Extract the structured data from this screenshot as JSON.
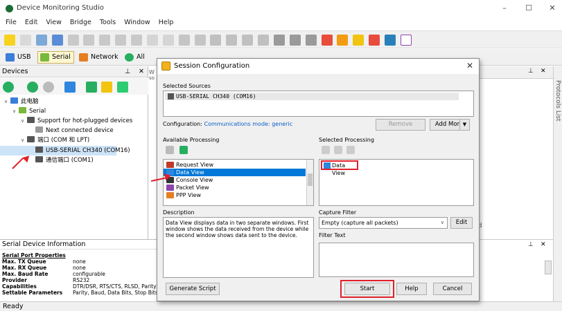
{
  "window": {
    "title": "Device Monitoring Studio",
    "min": "–",
    "max": "☐",
    "close": "✕"
  },
  "menu": [
    "File",
    "Edit",
    "View",
    "Bridge",
    "Tools",
    "Window",
    "Help"
  ],
  "tabs": [
    {
      "label": "USB"
    },
    {
      "label": "Serial"
    },
    {
      "label": "Network"
    },
    {
      "label": "All"
    }
  ],
  "devices_panel": {
    "title": "Devices",
    "pin": "⊥",
    "close": "✕",
    "tree": [
      {
        "label": "此电脑",
        "indent": 0,
        "twisty": "∨"
      },
      {
        "label": "Serial",
        "indent": 1,
        "twisty": "∨"
      },
      {
        "label": "Support for hot-plugged devices",
        "indent": 2,
        "twisty": "∨"
      },
      {
        "label": "Next connected device",
        "indent": 3,
        "twisty": ""
      },
      {
        "label": "端口 (COM 和 LPT)",
        "indent": 2,
        "twisty": "∨"
      },
      {
        "label": "USB-SERIAL CH340 (COM16)",
        "indent": 3,
        "twisty": "",
        "selected": true
      },
      {
        "label": "通信端口 (COM1)",
        "indent": 3,
        "twisty": ""
      }
    ]
  },
  "info_panel": {
    "title": "Serial Device Information",
    "section": "Serial Port Properties",
    "rows": [
      {
        "k": "Max. TX Queue",
        "v": "none"
      },
      {
        "k": "Max. RX Queue",
        "v": "none"
      },
      {
        "k": "Max. Baud Rate",
        "v": "configurable"
      },
      {
        "k": "Provider",
        "v": "RS232"
      },
      {
        "k": "Capabilities",
        "v": "DTR/DSR, RTS/CTS, RLSD, Parity"
      },
      {
        "k": "Settable Parameters",
        "v": "Parity, Baud, Data Bits, Stop Bits"
      }
    ]
  },
  "status": "Ready",
  "right_panel": {
    "pin": "⊥",
    "close": "✕",
    "frag_left_top": "W",
    "frag_left_sub": "so",
    "frag_bottom": "nd",
    "protocols": "Protocols List"
  },
  "dialog": {
    "title": "Session Configuration",
    "close": "✕",
    "selected_sources_label": "Selected Sources",
    "selected_source": "USB-SERIAL CH340 (COM16)",
    "configuration_prefix": "Configuration:",
    "configuration_value": "Communications mode: generic",
    "remove": "Remove",
    "add_more": "Add More",
    "add_more_arrow": "▼",
    "available_label": "Available Processing",
    "available_items": [
      {
        "label": "Request View",
        "color": "#c0392b"
      },
      {
        "label": "Data View",
        "color": "#2e86de",
        "selected": true
      },
      {
        "label": "Console View",
        "color": "#333333"
      },
      {
        "label": "Packet View",
        "color": "#8e44ad"
      },
      {
        "label": "PPP View",
        "color": "#e67e22"
      }
    ],
    "selected_processing_label": "Selected Processing",
    "selected_processing": [
      "Data View"
    ],
    "description_label": "Description",
    "description_text": "Data View displays data in two separate windows. First window shows the data received from the device while the second window shows data sent to the device.",
    "capture_filter_label": "Capture Filter",
    "capture_filter_value": "Empty (capture all packets)",
    "edit": "Edit",
    "filter_text_label": "Filter Text",
    "generate_script": "Generate Script",
    "start": "Start",
    "help": "Help",
    "cancel": "Cancel"
  },
  "colors": {
    "accent": "#0078d7",
    "highlight": "#e0202a"
  }
}
